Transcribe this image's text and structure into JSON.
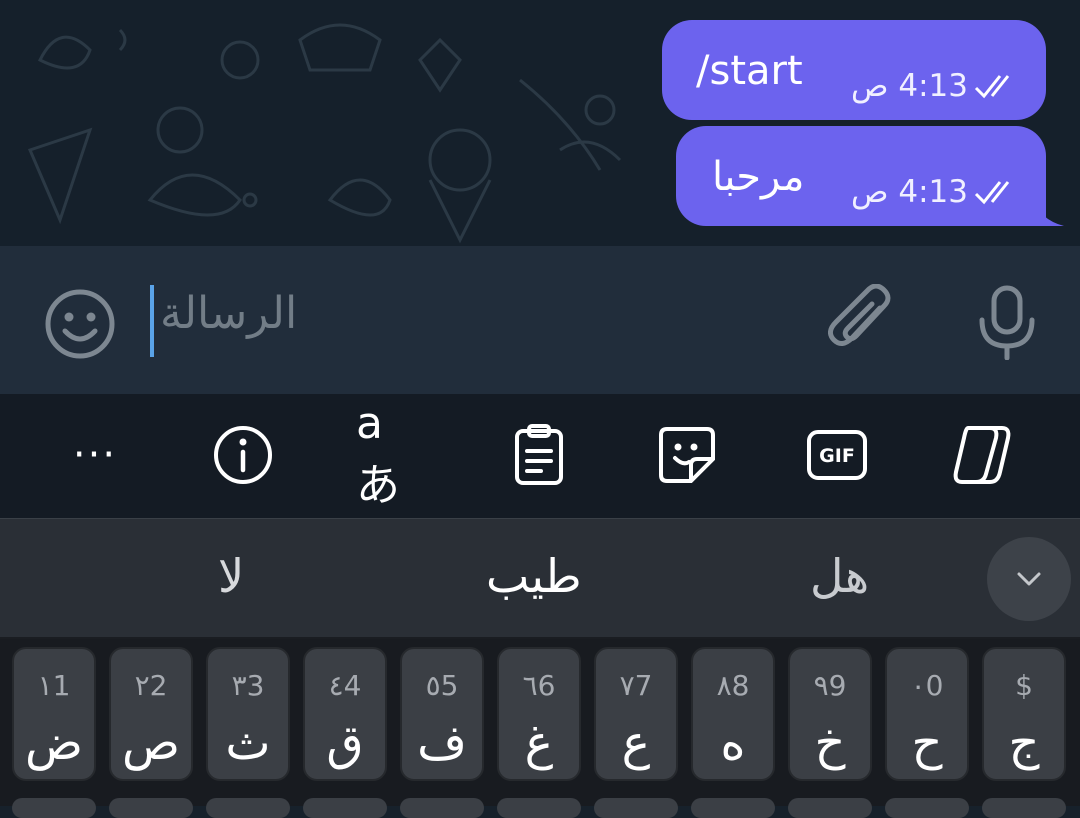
{
  "chat": {
    "messages": [
      {
        "text": "/start",
        "time": "4:13 ص"
      },
      {
        "text": "مرحبا",
        "time": "4:13 ص"
      }
    ]
  },
  "composer": {
    "placeholder": "الرسالة"
  },
  "toolbar": {
    "more_label": "···",
    "translate_label": "aあ",
    "gif_label": "GIF",
    "icons": [
      "more-icon",
      "info-icon",
      "translate-icon",
      "clipboard-icon",
      "sticker-icon",
      "gif-icon",
      "copilot-icon"
    ]
  },
  "suggestions": [
    "لا",
    "طيب",
    "هل"
  ],
  "keyboard": {
    "row1": [
      {
        "main": "ض",
        "hint": "١1"
      },
      {
        "main": "ص",
        "hint": "٢2"
      },
      {
        "main": "ث",
        "hint": "٣3"
      },
      {
        "main": "ق",
        "hint": "٤4"
      },
      {
        "main": "ف",
        "hint": "٥5"
      },
      {
        "main": "غ",
        "hint": "٦6"
      },
      {
        "main": "ع",
        "hint": "٧7"
      },
      {
        "main": "ه",
        "hint": "٨8"
      },
      {
        "main": "خ",
        "hint": "٩9"
      },
      {
        "main": "ح",
        "hint": "٠0"
      },
      {
        "main": "ج",
        "hint": "$"
      }
    ]
  },
  "colors": {
    "bubble": "#6c63ee",
    "chat_bg": "#15202b",
    "composer_bg": "#212d3b",
    "cursor": "#5aa3e8"
  }
}
